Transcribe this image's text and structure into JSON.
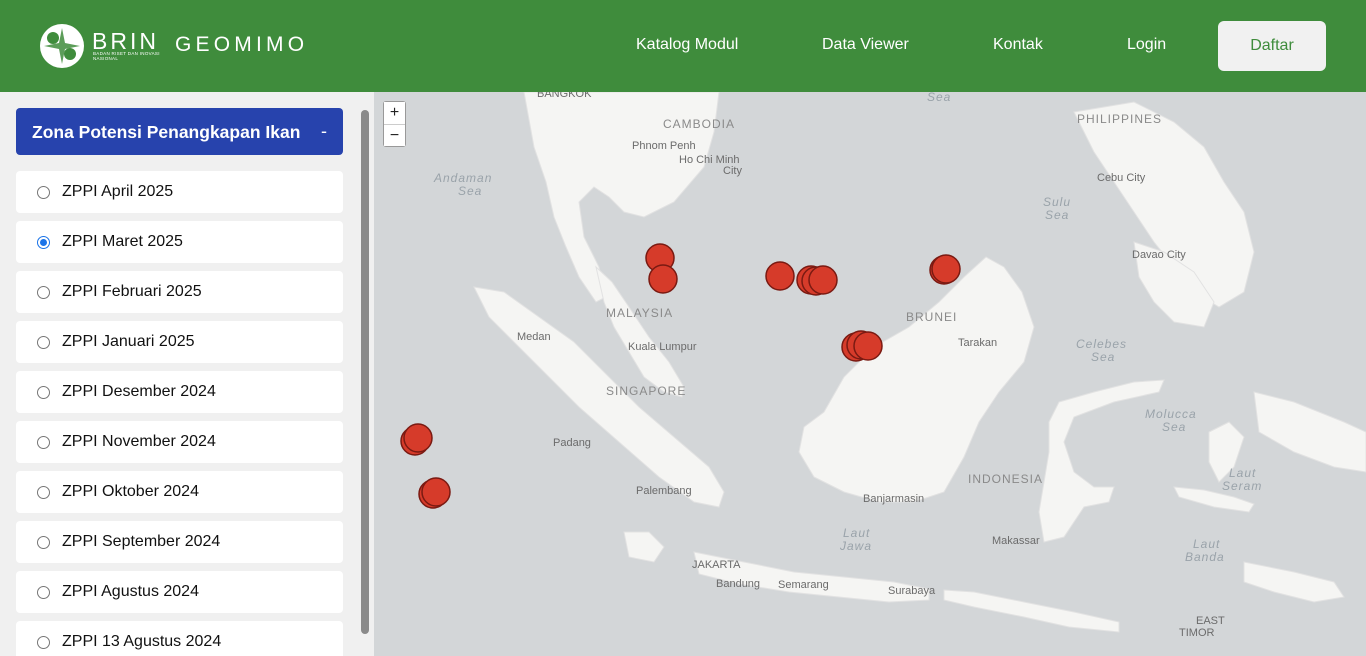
{
  "header": {
    "brand": "BRIN",
    "brand_sub": "BADAN RISET DAN INOVASI NASIONAL",
    "app_name": "GEOMIMO",
    "nav": [
      "Katalog Modul",
      "Data Viewer",
      "Kontak",
      "Login"
    ],
    "cta": "Daftar",
    "color": "#3f8c3c"
  },
  "sidebar": {
    "title": "Zona Potensi Penangkapan Ikan",
    "toggle": "-",
    "selected": "ZPPI Maret 2025",
    "items": [
      "ZPPI April 2025",
      "ZPPI Maret 2025",
      "ZPPI Februari 2025",
      "ZPPI Januari 2025",
      "ZPPI Desember 2024",
      "ZPPI November 2024",
      "ZPPI Oktober 2024",
      "ZPPI September 2024",
      "ZPPI Agustus 2024",
      "ZPPI 13 Agustus 2024"
    ]
  },
  "map": {
    "zoom_in": "+",
    "zoom_out": "−",
    "marker_color": "#d63b2a",
    "labels": {
      "bangkok": "BANGKOK",
      "cambodia": "CAMBODIA",
      "phnom_penh": "Phnom Penh",
      "hcmc_1": "Ho Chi Minh",
      "hcmc_2": "City",
      "andaman_1": "Andaman",
      "andaman_2": "Sea",
      "philippines": "PHILIPPINES",
      "cebu": "Cebu City",
      "sulu_1": "Sulu",
      "sulu_2": "Sea",
      "davao": "Davao City",
      "malaysia": "MALAYSIA",
      "medan": "Medan",
      "kuala_lumpur": "Kuala Lumpur",
      "brunei": "BRUNEI",
      "tarakan": "Tarakan",
      "celebes_1": "Celebes",
      "celebes_2": "Sea",
      "singapore": "SINGAPORE",
      "padang": "Padang",
      "molucca_1": "Molucca",
      "molucca_2": "Sea",
      "indonesia": "INDONESIA",
      "laut_seram_1": "Laut",
      "laut_seram_2": "Seram",
      "palembang": "Palembang",
      "banjarmasin": "Banjarmasin",
      "laut_jawa_1": "Laut",
      "laut_jawa_2": "Jawa",
      "makassar": "Makassar",
      "laut_banda_1": "Laut",
      "laut_banda_2": "Banda",
      "jakarta": "JAKARTA",
      "bandung": "Bandung",
      "semarang": "Semarang",
      "surabaya": "Surabaya",
      "east_timor_1": "EAST",
      "east_timor_2": "TIMOR",
      "sea_top": "Sea"
    }
  }
}
